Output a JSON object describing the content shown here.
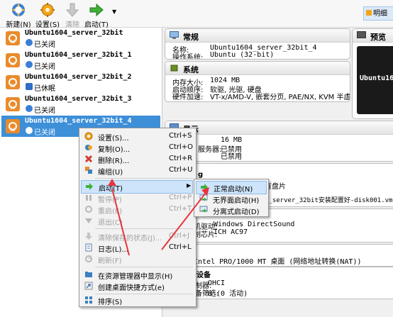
{
  "toolbar": {
    "new_label": "新建(N)",
    "settings_label": "设置(S)",
    "discard_label": "清除",
    "start_label": "启动(T)",
    "details_label": "明细",
    "new_icon": "starburst-new-icon",
    "settings_icon": "gear-icon",
    "discard_icon": "down-arrow-icon",
    "start_icon": "green-right-arrow-icon"
  },
  "vms": [
    {
      "name": "Ubuntu1604_server_32bit",
      "state": "已关闭",
      "state_icon": "power-off-icon"
    },
    {
      "name": "Ubuntu1604_server_32bit_1",
      "state": "已关闭",
      "state_icon": "power-off-icon"
    },
    {
      "name": "Ubuntu1604_server_32bit_2",
      "state": "已休眠",
      "state_icon": "saved-state-icon"
    },
    {
      "name": "Ubuntu1604_server_32bit_3",
      "state": "已关闭",
      "state_icon": "power-off-icon"
    },
    {
      "name": "Ubuntu1604_server_32bit_4",
      "state": "已关闭",
      "state_icon": "power-off-icon"
    }
  ],
  "general": {
    "title": "常规",
    "name_label": "名称:",
    "name_value": "Ubuntu1604_server_32bit_4",
    "os_label": "操作系统:",
    "os_value": "Ubuntu (32-bit)"
  },
  "system": {
    "title": "系统",
    "mem_label": "内存大小:",
    "mem_value": "1024 MB",
    "boot_label": "启动顺序:",
    "boot_value": "软驱, 光驱, 硬盘",
    "accel_label": "硬件加速:",
    "accel_value": "VT-x/AMD-V, 嵌套分页, PAE/NX, KVM 半虚拟化"
  },
  "preview": {
    "title": "预览",
    "screen_text": "Ubuntu16"
  },
  "display": {
    "title": "显示",
    "vram_value": "16 MB",
    "server_label_fragment": "服务器:",
    "remote_value": "已禁用",
    "record_value": "已禁用"
  },
  "storage": {
    "fragment_top": "g",
    "fragment_disk": "有盘片",
    "fragment_vmdk": "4_server_32bit安装配置好-disk001.vmdk (普通,"
  },
  "audio": {
    "host_driver_label": "主机驱动:",
    "host_driver_value": "Windows DirectSound",
    "controller_label": "控制芯片:",
    "controller_value": "ICH AC97"
  },
  "network": {
    "adapter_fragment": "Intel PRO/1000 MT 桌面 (网络地址转换(NAT))"
  },
  "usb": {
    "title_fragment": "设备",
    "controller_label": "控制器:",
    "controller_value": "OHCI",
    "filter_label": "设备筛选:",
    "filter_value": "0 (0 活动)"
  },
  "context_menu": [
    {
      "label": "设置(S)...",
      "shortcut": "Ctrl+S",
      "enabled": true,
      "icon": "gear-icon"
    },
    {
      "label": "复制(O)...",
      "shortcut": "Ctrl+O",
      "enabled": true,
      "icon": "clone-icon"
    },
    {
      "label": "删除(R)...",
      "shortcut": "Ctrl+R",
      "enabled": true,
      "icon": "delete-icon"
    },
    {
      "label": "编组(U)",
      "shortcut": "Ctrl+U",
      "enabled": true,
      "icon": "group-icon"
    },
    {
      "label": "启动(T)",
      "shortcut": "",
      "enabled": true,
      "icon": "start-icon",
      "submenu": true
    },
    {
      "label": "暂停(P)",
      "shortcut": "Ctrl+P",
      "enabled": false,
      "icon": "pause-icon"
    },
    {
      "label": "重启(E)",
      "shortcut": "Ctrl+T",
      "enabled": false,
      "icon": "reset-icon"
    },
    {
      "label": "退出(C)",
      "shortcut": "",
      "enabled": false,
      "icon": "close-vm-icon"
    },
    {
      "label": "清除保存的状态(J)...",
      "shortcut": "Ctrl+J",
      "enabled": false,
      "icon": "discard-icon"
    },
    {
      "label": "日志(L)...",
      "shortcut": "Ctrl+L",
      "enabled": true,
      "icon": "log-icon"
    },
    {
      "label": "刷新(F)",
      "shortcut": "",
      "enabled": false,
      "icon": "refresh-icon"
    },
    {
      "label": "在资源管理器中显示(H)",
      "shortcut": "",
      "enabled": true,
      "icon": "folder-icon"
    },
    {
      "label": "创建桌面快捷方式(e)",
      "shortcut": "",
      "enabled": true,
      "icon": "shortcut-icon"
    },
    {
      "label": "排序(S)",
      "shortcut": "",
      "enabled": true,
      "icon": "sort-icon"
    }
  ],
  "start_submenu": [
    {
      "label": "正常启动(N)",
      "icon": "normal-start-icon"
    },
    {
      "label": "无界面启动(H)",
      "icon": "headless-start-icon"
    },
    {
      "label": "分离式启动(D)",
      "icon": "detachable-start-icon"
    }
  ],
  "colors": {
    "selection": "#3d8fd8",
    "highlight": "#cde4fb",
    "annotation_arrow": "#e8343c"
  }
}
